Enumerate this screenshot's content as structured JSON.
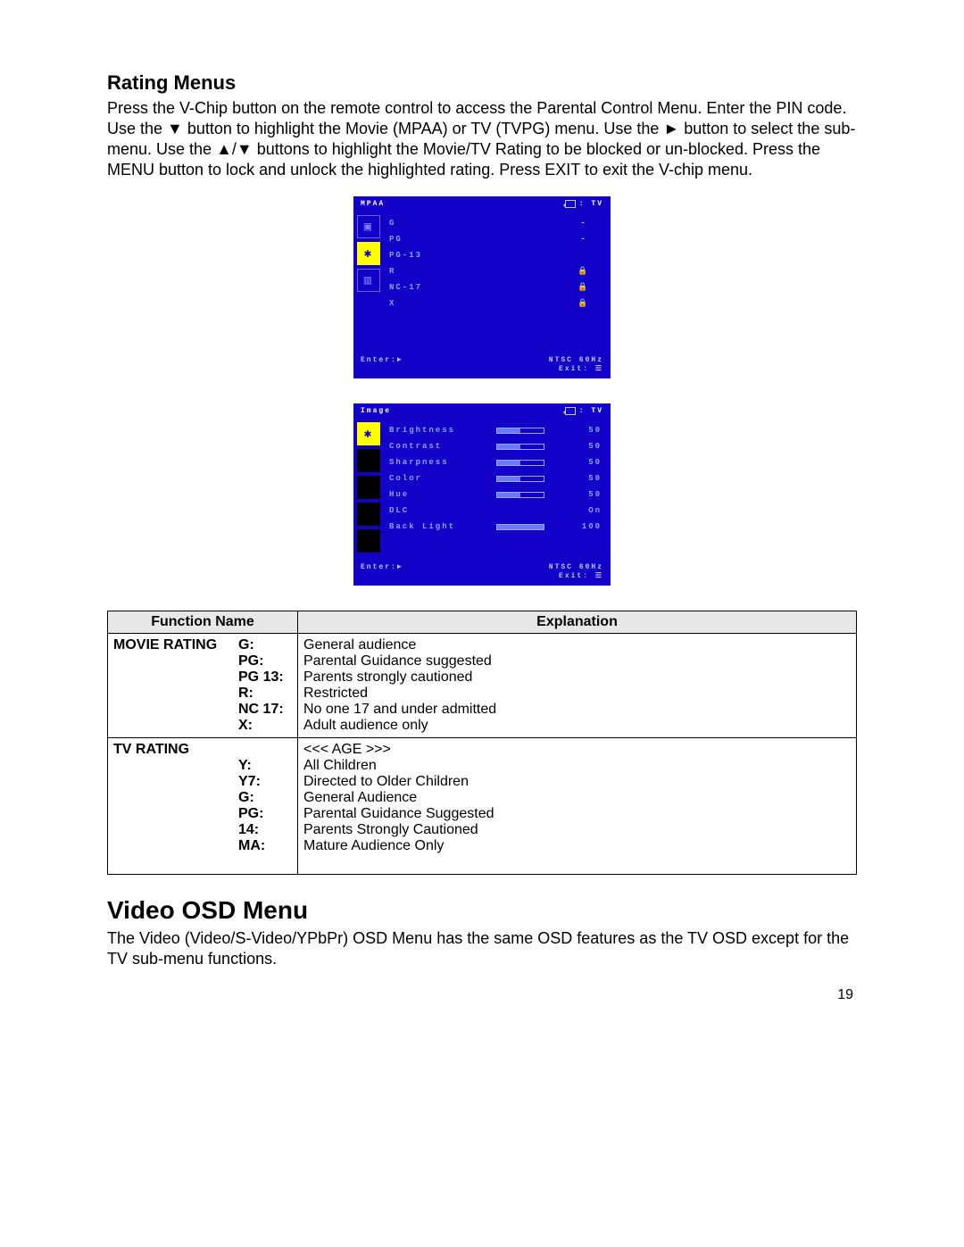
{
  "section1": {
    "heading": "Rating Menus",
    "paragraph": "Press the V-Chip button on the remote control to access the Parental Control Menu. Enter the PIN code. Use the ▼ button to highlight the Movie (MPAA) or TV (TVPG) menu. Use the ► button to select the sub-menu. Use the ▲/▼ buttons to highlight the Movie/TV Rating to be blocked or un-blocked. Press the MENU button to lock and unlock the highlighted rating. Press EXIT to exit the V-chip menu."
  },
  "osd_mpaa": {
    "title": "MPAA",
    "source": ": TV",
    "rows": [
      {
        "label": "G",
        "lock": "-"
      },
      {
        "label": "PG",
        "lock": "-"
      },
      {
        "label": "PG-13",
        "lock": ""
      },
      {
        "label": "R",
        "lock": "🔒"
      },
      {
        "label": "NC-17",
        "lock": "🔒"
      },
      {
        "label": "X",
        "lock": "🔒"
      }
    ],
    "footer_left": "Enter:►",
    "footer_r1": "NTSC  60Hz",
    "footer_r2": "Exit: ☰"
  },
  "osd_image": {
    "title": "Image",
    "source": ": TV",
    "rows": [
      {
        "label": "Brightness",
        "pct": 50,
        "val": "50"
      },
      {
        "label": "Contrast",
        "pct": 50,
        "val": "50"
      },
      {
        "label": "Sharpness",
        "pct": 50,
        "val": "50"
      },
      {
        "label": "Color",
        "pct": 50,
        "val": "50"
      },
      {
        "label": "Hue",
        "pct": 50,
        "val": "50"
      },
      {
        "label": "DLC",
        "pct": null,
        "val": "On"
      },
      {
        "label": "Back Light",
        "pct": 100,
        "val": "100"
      }
    ],
    "footer_left": "Enter:►",
    "footer_r1": "NTSC  60Hz",
    "footer_r2": "Exit: ☰"
  },
  "table": {
    "head_fn": "Function Name",
    "head_ex": "Explanation",
    "movie": {
      "title": "MOVIE RATING",
      "rows": [
        {
          "k": "G:",
          "v": "General audience"
        },
        {
          "k": "PG:",
          "v": "Parental Guidance suggested"
        },
        {
          "k": "PG 13:",
          "v": "Parents strongly cautioned"
        },
        {
          "k": "R:",
          "v": "Restricted"
        },
        {
          "k": "NC 17:",
          "v": "No one 17 and under admitted"
        },
        {
          "k": "X:",
          "v": "Adult audience only"
        }
      ]
    },
    "tv": {
      "title": "TV RATING",
      "age_header": "<<< AGE >>>",
      "rows": [
        {
          "k": "Y:",
          "v": "All Children"
        },
        {
          "k": "Y7:",
          "v": "Directed to Older Children"
        },
        {
          "k": "G:",
          "v": "General Audience"
        },
        {
          "k": "PG:",
          "v": "Parental Guidance Suggested"
        },
        {
          "k": "14:",
          "v": "Parents Strongly Cautioned"
        },
        {
          "k": "MA:",
          "v": "Mature Audience Only"
        }
      ]
    }
  },
  "section2": {
    "heading": "Video OSD Menu",
    "paragraph": "The Video (Video/S-Video/YPbPr) OSD Menu has the same OSD features as the TV OSD except for the TV sub-menu functions."
  },
  "page_number": "19"
}
